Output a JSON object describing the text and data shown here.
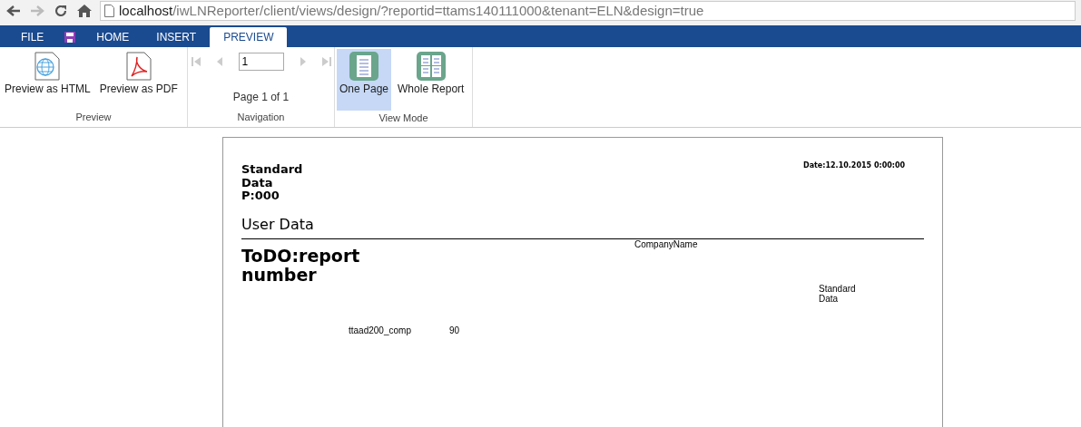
{
  "browser": {
    "back_disabled": false,
    "forward_disabled": true,
    "url_host": "localhost",
    "url_path": "/iwLNReporter/client/views/design/?reportid=ttams140111000&tenant=ELN&design=true"
  },
  "tabs": [
    {
      "kind": "text",
      "label": "FILE",
      "selected": false
    },
    {
      "kind": "save"
    },
    {
      "kind": "text",
      "label": "HOME",
      "selected": false
    },
    {
      "kind": "text",
      "label": "INSERT",
      "selected": false
    },
    {
      "kind": "text",
      "label": "PREVIEW",
      "selected": true
    }
  ],
  "ribbon": {
    "preview": {
      "title": "Preview",
      "buttons": [
        {
          "kind": "html",
          "label": "Preview as HTML"
        },
        {
          "kind": "pdf",
          "label": "Preview as PDF"
        }
      ]
    },
    "navigation": {
      "title": "Navigation",
      "page_value": "1",
      "page_text": "Page 1 of 1",
      "disabled": true
    },
    "view_mode": {
      "title": "View Mode",
      "buttons": [
        {
          "kind": "one",
          "label": "One Page",
          "selected": true
        },
        {
          "kind": "whole",
          "label": "Whole Report",
          "selected": false
        }
      ]
    }
  },
  "report": {
    "header_title": "Standard\nData\nP:000",
    "date": "Date:12.10.2015 0:00:00",
    "section": "User Data",
    "report_number": "ToDO:report\nnumber",
    "company_name": "CompanyName",
    "standard_data": "Standard\nData",
    "field_name": "ttaad200_comp",
    "field_value": "90"
  }
}
